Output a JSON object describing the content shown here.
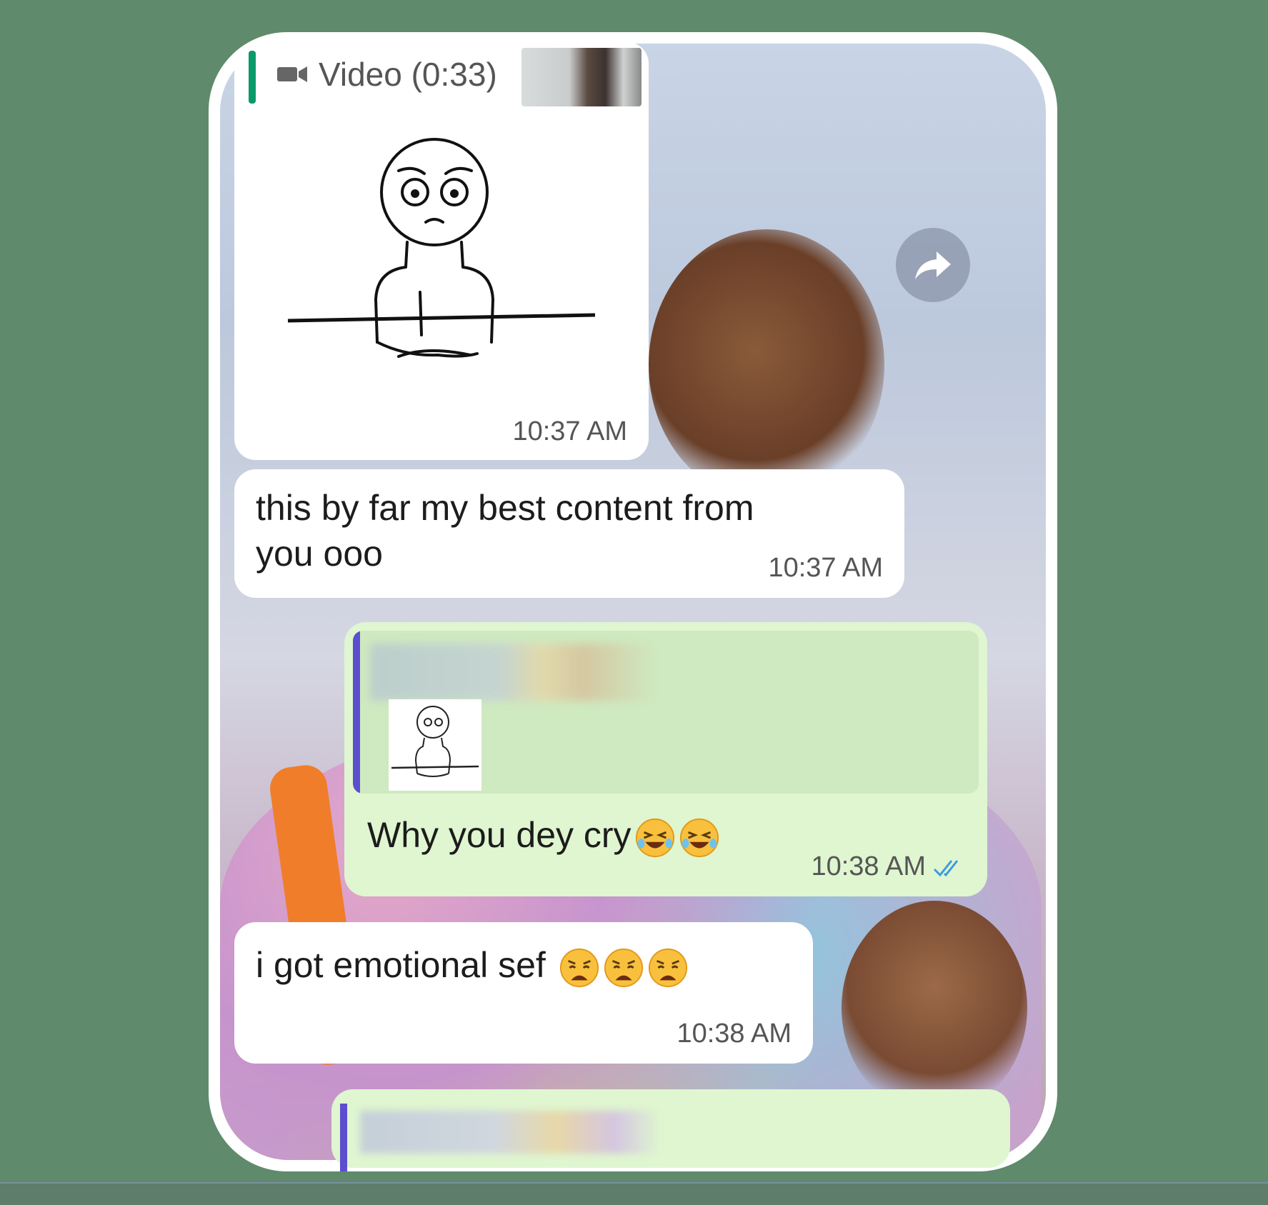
{
  "messages": [
    {
      "direction": "incoming",
      "reply_label": "Video (0:33)",
      "reply_icon": "video-camera-icon",
      "media": "sad-meme-character",
      "time": "10:37 AM"
    },
    {
      "direction": "incoming",
      "text_line1": "this by far my best content from",
      "text_line2": "you ooo",
      "time": "10:37 AM"
    },
    {
      "direction": "outgoing",
      "quoted_media": "sad-meme-character-thumbnail",
      "text": "Why you dey cry",
      "emojis": [
        "rolling-on-floor-laughing-emoji",
        "rolling-on-floor-laughing-emoji"
      ],
      "time": "10:38 AM",
      "status": "read-double-check-icon"
    },
    {
      "direction": "incoming",
      "text": "i got emotional sef",
      "emojis": [
        "weary-face-emoji",
        "weary-face-emoji",
        "weary-face-emoji"
      ],
      "time": "10:38 AM"
    },
    {
      "direction": "outgoing",
      "partial": true
    }
  ],
  "colors": {
    "page_background": "#5f8a6c",
    "incoming_bubble": "#ffffff",
    "outgoing_bubble": "#dff6d0",
    "reply_bar_incoming": "#0a9a6a",
    "reply_bar_outgoing": "#5b4fd0",
    "read_ticks": "#3b9be0"
  }
}
